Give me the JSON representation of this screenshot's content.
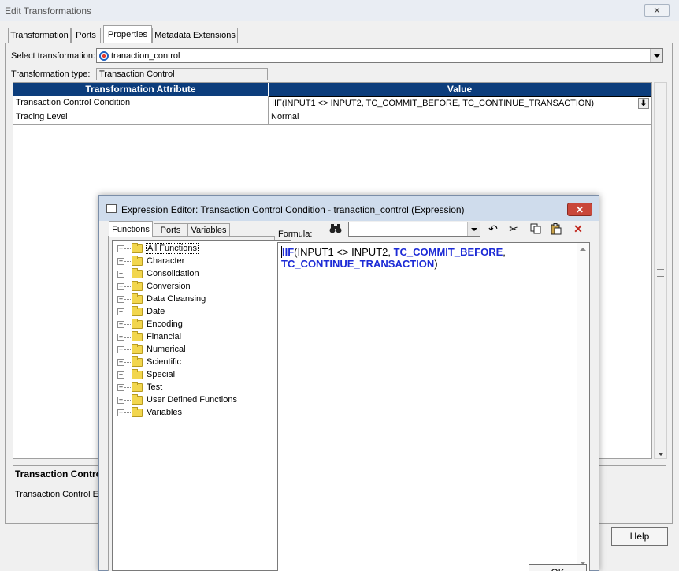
{
  "outer": {
    "title": "Edit Transformations",
    "tabs": [
      {
        "label": "Transformation"
      },
      {
        "label": "Ports"
      },
      {
        "label": "Properties"
      },
      {
        "label": "Metadata Extensions"
      }
    ],
    "select_label": "Select transformation:",
    "select_value": "tranaction_control",
    "type_label": "Transformation type:",
    "type_value": "Transaction Control",
    "grid": {
      "headers": [
        "Transformation Attribute",
        "Value"
      ],
      "rows": [
        {
          "attribute": "Transaction Control Condition",
          "value": "IIF(INPUT1 <> INPUT2, TC_COMMIT_BEFORE, TC_CONTINUE_TRANSACTION)"
        },
        {
          "attribute": "Tracing Level",
          "value": "Normal"
        }
      ]
    },
    "description": {
      "title": "Transaction Control",
      "text": "Transaction Control Ex"
    },
    "help_label": "Help"
  },
  "expr": {
    "title": "Expression Editor: Transaction Control Condition - tranaction_control (Expression)",
    "close_label": "✕",
    "tabs": [
      {
        "label": "Functions"
      },
      {
        "label": "Ports"
      },
      {
        "label": "Variables"
      }
    ],
    "tree": [
      {
        "label": "All Functions"
      },
      {
        "label": "Character"
      },
      {
        "label": "Consolidation"
      },
      {
        "label": "Conversion"
      },
      {
        "label": "Data Cleansing"
      },
      {
        "label": "Date"
      },
      {
        "label": "Encoding"
      },
      {
        "label": "Financial"
      },
      {
        "label": "Numerical"
      },
      {
        "label": "Scientific"
      },
      {
        "label": "Special"
      },
      {
        "label": "Test"
      },
      {
        "label": "User Defined Functions"
      },
      {
        "label": "Variables"
      }
    ],
    "formula_label": "Formula:",
    "formula_search_value": "",
    "formula": {
      "fn": "IIF",
      "open": "(INPUT1 <> INPUT2, ",
      "kw1": "TC_COMMIT_BEFORE",
      "comma": ",",
      "kw2": "TC_CONTINUE_TRANSACTION",
      "close": ")"
    },
    "ok_label": "OK"
  },
  "colors": {
    "grid_header": "#0c3d7c",
    "keyword": "#1d2bd6",
    "close_button": "#c9473a"
  }
}
